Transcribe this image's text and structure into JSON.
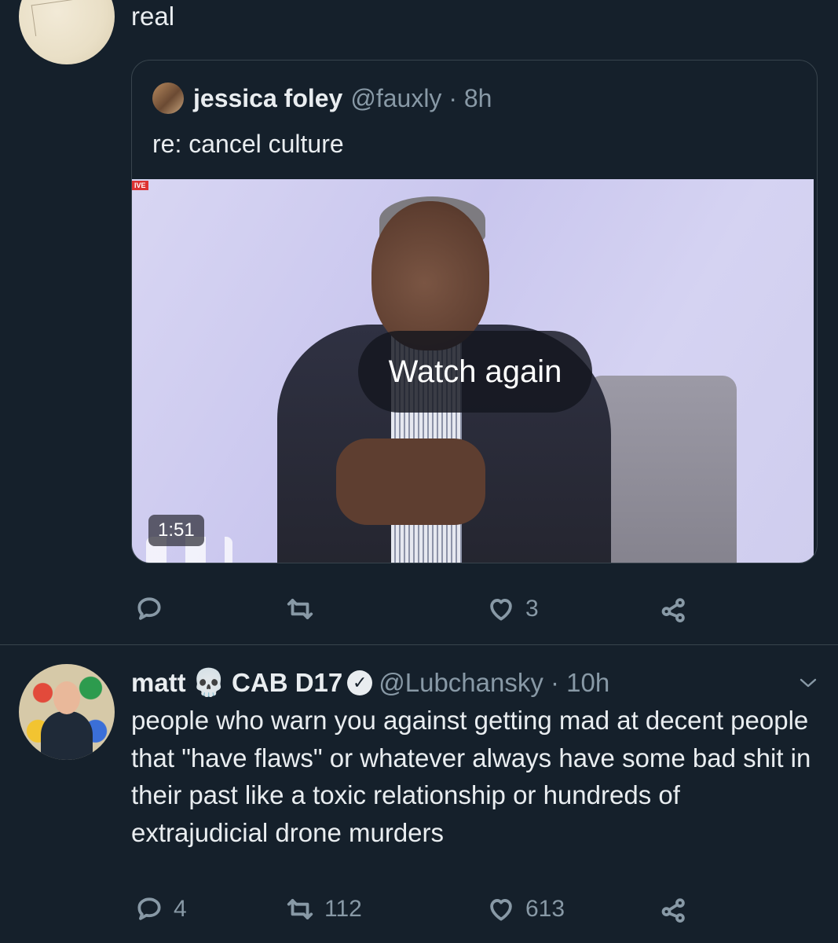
{
  "top_tweet": {
    "text": "real"
  },
  "quoted_tweet": {
    "name": "jessica foley",
    "handle": "@fauxly · 8h",
    "text": "re: cancel culture",
    "video": {
      "live_tag": "IVE",
      "overlay_label": "Watch again",
      "duration": "1:51"
    }
  },
  "top_actions": {
    "reply_icon": "reply-icon",
    "retweet_icon": "retweet-icon",
    "like_icon": "heart-icon",
    "like_count": "3",
    "share_icon": "share-icon"
  },
  "second_tweet": {
    "name": "matt",
    "emoji": "💀",
    "name_suffix": "CAB D17",
    "verified_mark": "✓",
    "handle": "@Lubchansky · 10h",
    "text": "people who warn you against getting mad at decent people that \"have flaws\" or whatever always have some bad shit in their past like a toxic relationship or hundreds of extrajudicial drone murders",
    "actions": {
      "reply_count": "4",
      "retweet_count": "112",
      "like_count": "613"
    }
  },
  "colors": {
    "background": "#15202b",
    "border": "#38444d",
    "secondary_text": "#8899a6",
    "primary_text": "#e9edf0"
  }
}
